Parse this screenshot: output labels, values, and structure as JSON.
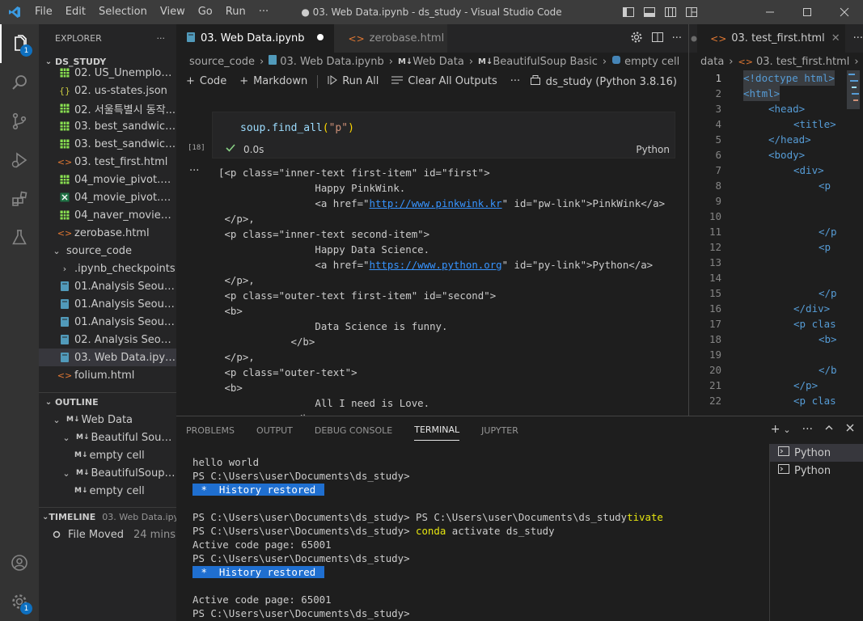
{
  "window": {
    "title": "● 03. Web Data.ipynb - ds_study - Visual Studio Code",
    "menu": [
      "File",
      "Edit",
      "Selection",
      "View",
      "Go",
      "Run",
      "···"
    ]
  },
  "activity": {
    "explorer_badge": "1",
    "manage_badge": "1"
  },
  "explorer": {
    "header": "EXPLORER",
    "more": "···",
    "root": "DS_STUDY",
    "files": [
      {
        "icon": "csv",
        "label": "02. US_Unemploym..."
      },
      {
        "icon": "json",
        "label": "02. us-states.json"
      },
      {
        "icon": "csv",
        "label": "02. 서울특별시 동작..."
      },
      {
        "icon": "csv",
        "label": "03. best_sandwiches..."
      },
      {
        "icon": "csv",
        "label": "03. best_sandwiches..."
      },
      {
        "icon": "html",
        "label": "03. test_first.html"
      },
      {
        "icon": "csv",
        "label": "04_movie_pivot.csv"
      },
      {
        "icon": "xlsx",
        "label": "04_movie_pivot.xlsx"
      },
      {
        "icon": "csv",
        "label": "04_naver_movie_raw..."
      },
      {
        "icon": "html",
        "label": "zerobase.html"
      }
    ],
    "folder": "source_code",
    "subfolder": ".ipynb_checkpoints",
    "notebooks": [
      {
        "icon": "nb",
        "label": "01.Analysis Seoul CC..."
      },
      {
        "icon": "nb",
        "label": "01.Analysis Seoul CC..."
      },
      {
        "icon": "nb",
        "label": "01.Analysis Seoul CC..."
      },
      {
        "icon": "nb",
        "label": "02. Analysis Seoul Cr..."
      },
      {
        "icon": "nb",
        "label": "03. Web Data.ipynb"
      },
      {
        "icon": "html",
        "label": "folium.html"
      }
    ]
  },
  "outline": {
    "title": "OUTLINE",
    "items": [
      {
        "level": 0,
        "label": "Web Data"
      },
      {
        "level": 1,
        "label": "Beautiful Soup ..."
      },
      {
        "level": 2,
        "label": "empty cell"
      },
      {
        "level": 1,
        "label": "BeautifulSoup ..."
      },
      {
        "level": 2,
        "label": "empty cell"
      }
    ]
  },
  "timeline": {
    "title": "TIMELINE",
    "file": "03. Web Data.ipy...",
    "event": "File Moved",
    "time": "24 mins"
  },
  "editor1": {
    "tabs": [
      {
        "label": "03. Web Data.ipynb",
        "active": true
      },
      {
        "label": "zerobase.html",
        "active": false
      }
    ],
    "breadcrumb": [
      "source_code",
      "03. Web Data.ipynb",
      "Web Data",
      "BeautifulSoup Basic",
      "empty cell"
    ],
    "toolbar": {
      "code": "Code",
      "markdown": "Markdown",
      "run_all": "Run All",
      "clear": "Clear All Outputs",
      "more": "···",
      "kernel": "ds_study (Python 3.8.16)"
    },
    "cell": {
      "code_fn": "soup.find_all",
      "code_arg": "\"p\"",
      "exec_count": "[18]",
      "time": "0.0s",
      "language": "Python"
    },
    "output_lines": [
      "[<p class=\"inner-text first-item\" id=\"first\">",
      "                Happy PinkWink.",
      "                <a href=\"|http://www.pinkwink.kr|\" id=\"pw-link\">PinkWink</a>",
      " </p>,",
      " <p class=\"inner-text second-item\">",
      "                Happy Data Science.",
      "                <a href=\"|https://www.python.org|\" id=\"py-link\">Python</a>",
      " </p>,",
      " <p class=\"outer-text first-item\" id=\"second\">",
      " <b>",
      "                Data Science is funny.",
      "            </b>",
      " </p>,",
      " <p class=\"outer-text\">",
      " <b>",
      "                All I need is Love.",
      "            </b>"
    ]
  },
  "editor2": {
    "tab": "03. test_first.html",
    "breadcrumb": [
      "data",
      "03. test_first.html",
      "..."
    ],
    "lines": [
      {
        "n": "1",
        "indent": 0,
        "code": "<!doctype html>"
      },
      {
        "n": "2",
        "indent": 0,
        "code": "<html>"
      },
      {
        "n": "3",
        "indent": 1,
        "code": "<head>"
      },
      {
        "n": "4",
        "indent": 2,
        "code": "<title>"
      },
      {
        "n": "5",
        "indent": 1,
        "code": "</head>"
      },
      {
        "n": "6",
        "indent": 1,
        "code": "<body>"
      },
      {
        "n": "7",
        "indent": 2,
        "code": "<div>"
      },
      {
        "n": "8",
        "indent": 3,
        "code": "<p"
      },
      {
        "n": "9",
        "indent": 0,
        "code": ""
      },
      {
        "n": "10",
        "indent": 0,
        "code": ""
      },
      {
        "n": "11",
        "indent": 3,
        "code": "</p"
      },
      {
        "n": "12",
        "indent": 3,
        "code": "<p"
      },
      {
        "n": "13",
        "indent": 0,
        "code": ""
      },
      {
        "n": "14",
        "indent": 0,
        "code": ""
      },
      {
        "n": "15",
        "indent": 3,
        "code": "</p"
      },
      {
        "n": "16",
        "indent": 2,
        "code": "</div>"
      },
      {
        "n": "17",
        "indent": 2,
        "code": "<p clas"
      },
      {
        "n": "18",
        "indent": 3,
        "code": "<b>"
      },
      {
        "n": "19",
        "indent": 0,
        "code": ""
      },
      {
        "n": "20",
        "indent": 3,
        "code": "</b"
      },
      {
        "n": "21",
        "indent": 2,
        "code": "</p>"
      },
      {
        "n": "22",
        "indent": 2,
        "code": "<p clas"
      }
    ]
  },
  "panel": {
    "tabs": [
      "PROBLEMS",
      "OUTPUT",
      "DEBUG CONSOLE",
      "TERMINAL",
      "JUPYTER"
    ],
    "active_tab": "TERMINAL",
    "terminal_lines": [
      {
        "text": "hello world"
      },
      {
        "text": "PS C:\\Users\\user\\Documents\\ds_study>"
      },
      {
        "hist": " *  History restored "
      },
      {
        "text": ""
      },
      {
        "text": "PS C:\\Users\\user\\Documents\\ds_study> PS C:\\Users\\user\\Documents\\ds_study",
        "yel": "tivate"
      },
      {
        "text": "PS C:\\Users\\user\\Documents\\ds_study> ",
        "yel": "conda",
        "rest": " activate ds_study"
      },
      {
        "text": "Active code page: 65001"
      },
      {
        "text": "PS C:\\Users\\user\\Documents\\ds_study>"
      },
      {
        "hist": " *  History restored "
      },
      {
        "text": ""
      },
      {
        "text": "Active code page: 65001"
      },
      {
        "text": "PS C:\\Users\\user\\Documents\\ds_study>"
      }
    ],
    "terminals": [
      "Python",
      "Python"
    ]
  },
  "colors": {
    "accent": "#007acc",
    "badge": "#0e70c0",
    "html_tag": "#569cd6",
    "string": "#ce9178",
    "link": "#3794ff",
    "terminal_yellow": "#e5e510"
  }
}
